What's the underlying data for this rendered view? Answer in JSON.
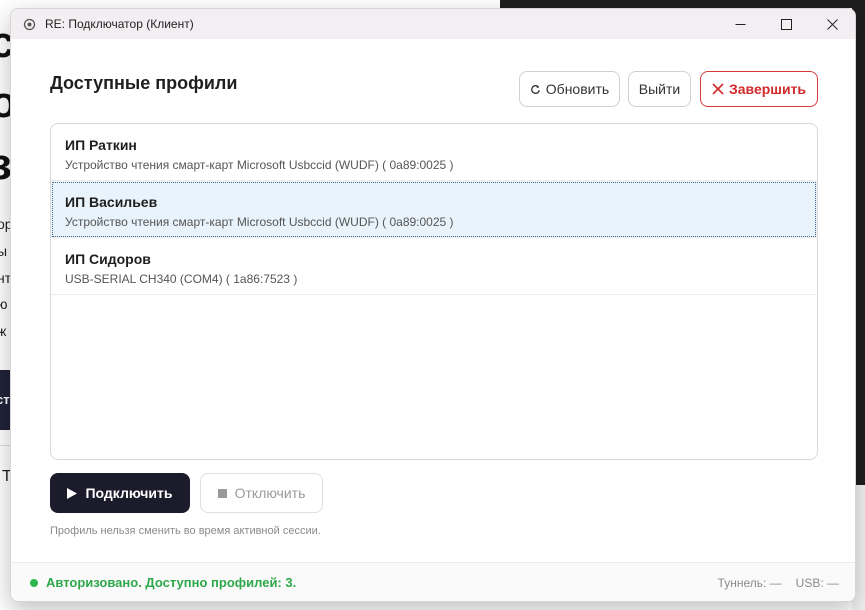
{
  "background": {
    "big_letters": [
      "с",
      "о",
      "з"
    ],
    "small_letters": [
      "ор",
      "ы",
      "нт",
      "ю",
      "ж"
    ],
    "dark_button_text": "ст",
    "letter_t": "Т"
  },
  "window": {
    "title": "RE: Подключатор (Клиент)",
    "heading": "Доступные профили"
  },
  "toolbar": {
    "refresh_label": "Обновить",
    "logout_label": "Выйти",
    "finish_label": "Завершить"
  },
  "profiles": [
    {
      "name": "ИП Раткин",
      "device": "Устройство чтения смарт-карт Microsoft Usbccid (WUDF)  ( 0a89:0025 )",
      "selected": false
    },
    {
      "name": "ИП Васильев",
      "device": "Устройство чтения смарт-карт Microsoft Usbccid (WUDF)  ( 0a89:0025 )",
      "selected": true
    },
    {
      "name": "ИП Сидоров",
      "device": "USB-SERIAL CH340 (COM4)  ( 1a86:7523 )",
      "selected": false
    }
  ],
  "actions": {
    "connect_label": "Подключить",
    "disconnect_label": "Отключить",
    "hint": "Профиль нельзя сменить во время активной сессии."
  },
  "status": {
    "text": "Авторизовано. Доступно профилей: 3.",
    "tunnel": "Туннель: —",
    "usb": "USB: —"
  },
  "colors": {
    "accent_dark": "#1c1b2b",
    "danger": "#d12a2a",
    "success": "#2ea84a",
    "selected_bg": "#e9f3fb"
  },
  "icons": {
    "refresh": "refresh-icon",
    "finish": "close-x-icon",
    "connect": "play-icon",
    "disconnect": "stop-icon"
  }
}
